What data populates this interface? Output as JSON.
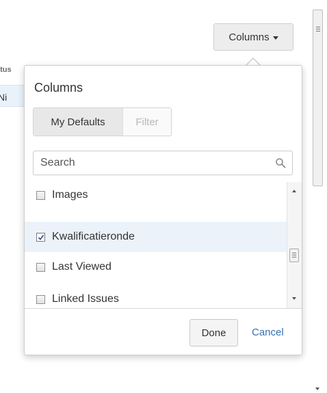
{
  "background": {
    "status_header": "atus",
    "cell_text": "Ni"
  },
  "columns_button": {
    "label": "Columns"
  },
  "popup": {
    "title": "Columns",
    "tabs": [
      {
        "label": "My Defaults",
        "active": true
      },
      {
        "label": "Filter",
        "active": false
      }
    ],
    "search": {
      "placeholder": "Search",
      "value": ""
    },
    "items": [
      {
        "label": "Images",
        "checked": false
      },
      {
        "label": "Kwalificatieronde",
        "checked": true
      },
      {
        "label": "Last Viewed",
        "checked": false
      },
      {
        "label": "Linked Issues",
        "checked": false
      }
    ],
    "done_label": "Done",
    "cancel_label": "Cancel"
  },
  "colors": {
    "link": "#3572b0",
    "selected_row": "#ebf2f9",
    "button_bg": "#ededed"
  },
  "icons": {
    "search": "magnifier",
    "dropdown": "caret-down",
    "check": "checkmark"
  }
}
